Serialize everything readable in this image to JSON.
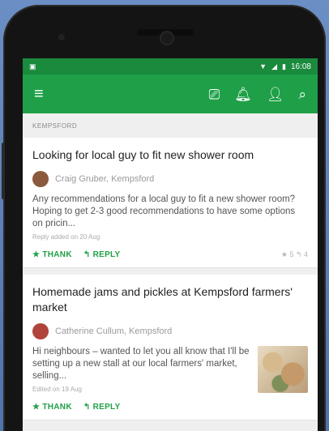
{
  "statusbar": {
    "time": "16:08"
  },
  "icons": {
    "menu": "menu-icon",
    "inbox": "inbox-icon",
    "bell": "bell-icon",
    "add_person": "add-person-icon",
    "search": "search-icon"
  },
  "colors": {
    "app_bar": "#1fa048",
    "status_bar": "#1a8a3c",
    "action": "#1fa048"
  },
  "section": {
    "label": "KEMPSFORD"
  },
  "posts": [
    {
      "title": "Looking for local guy to fit new shower room",
      "author": "Craig Gruber, Kempsford",
      "body": "Any recommendations for a local guy to fit a new shower room? Hoping to get 2-3 good recommendations to have some options on pricin...",
      "meta": "Reply added on 20 Aug",
      "thank_label": "★ THANK",
      "reply_label": "↰ REPLY",
      "counts": "★ 5   ↰ 4"
    },
    {
      "title": "Homemade jams and pickles at Kempsford farmers' market",
      "author": "Catherine Cullum, Kempsford",
      "body": "Hi neighbours – wanted to let you all know that I'll be setting up a new stall at our local farmers' market, selling...",
      "meta": "Edited on 19 Aug",
      "thank_label": "★ THANK",
      "reply_label": "↰ REPLY",
      "counts": ""
    }
  ]
}
